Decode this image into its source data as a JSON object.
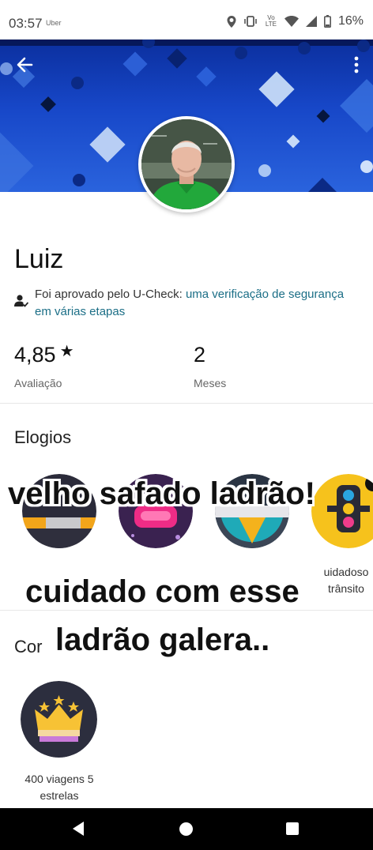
{
  "status_bar": {
    "time": "03:57",
    "app_label": "Uber",
    "battery": "16%",
    "volte_label": "Vo LTE"
  },
  "header": {
    "back_icon": "arrow-left-icon",
    "more_icon": "more-vert-icon"
  },
  "profile": {
    "name": "Luiz",
    "verification_text": "Foi aprovado pelo U-Check: ",
    "verification_link": "uma verificação de segurança em várias etapas",
    "rating_value": "4,85",
    "rating_star": "★",
    "rating_label": "Avaliação",
    "months_value": "2",
    "months_label": "Meses"
  },
  "compliments": {
    "title": "Elogios",
    "badges": [
      {
        "name": "compliment-badge-1"
      },
      {
        "name": "compliment-badge-2"
      },
      {
        "name": "compliment-badge-3"
      },
      {
        "name": "compliment-badge-4",
        "label_line1": "uidadoso",
        "label_line2": "trânsito"
      }
    ]
  },
  "achievements": {
    "title": "Cor",
    "items": [
      {
        "label_line1": "400 viagens 5",
        "label_line2": "estrelas"
      }
    ]
  },
  "overlay_text": {
    "line1": "velho safado ladrão!",
    "line2": "cuidado com esse",
    "line3": "ladrão galera.."
  },
  "colors": {
    "banner": "#1747c8",
    "link": "#1b6e86",
    "avatar_shirt": "#1fa83a"
  }
}
